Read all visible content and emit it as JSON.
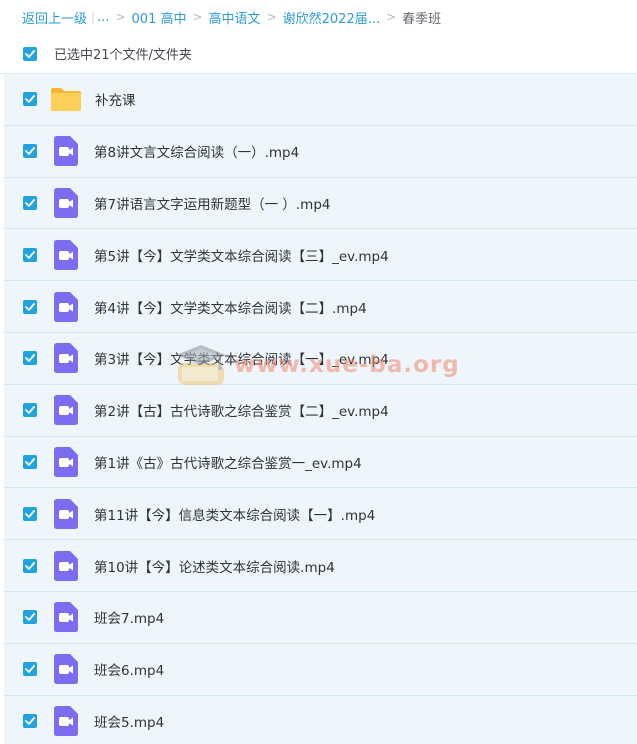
{
  "breadcrumb": {
    "back": "返回上一级",
    "ellipsis": "...",
    "items": [
      "001 高中",
      "高中语文",
      "谢欣然2022届..."
    ],
    "current": "春季班"
  },
  "selection": {
    "label": "已选中21个文件/文件夹"
  },
  "files": [
    {
      "name": "补充课",
      "type": "folder"
    },
    {
      "name": "第8讲文言文综合阅读（一）.mp4",
      "type": "video"
    },
    {
      "name": "第7讲语言文字运用新题型（一 ）.mp4",
      "type": "video"
    },
    {
      "name": "第5讲【今】文学类文本综合阅读【三】_ev.mp4",
      "type": "video"
    },
    {
      "name": "第4讲【今】文学类文本综合阅读【二】.mp4",
      "type": "video"
    },
    {
      "name": "第3讲【今】文学类文本综合阅读【一】_ev.mp4",
      "type": "video"
    },
    {
      "name": "第2讲【古】古代诗歌之综合鉴赏【二】_ev.mp4",
      "type": "video"
    },
    {
      "name": "第1讲《古》古代诗歌之综合鉴赏一_ev.mp4",
      "type": "video"
    },
    {
      "name": "第11讲【今】信息类文本综合阅读【一】.mp4",
      "type": "video"
    },
    {
      "name": "第10讲【今】论述类文本综合阅读.mp4",
      "type": "video"
    },
    {
      "name": "班会7.mp4",
      "type": "video"
    },
    {
      "name": "班会6.mp4",
      "type": "video"
    },
    {
      "name": "班会5.mp4",
      "type": "video"
    }
  ],
  "watermark": {
    "text": "www.xue-ba.org"
  },
  "colors": {
    "accent": "#22a3e0",
    "link": "#2b9bd6",
    "row_bg": "#eef6fc",
    "video_icon": "#7b6cf0",
    "folder": "#fcc84a"
  }
}
